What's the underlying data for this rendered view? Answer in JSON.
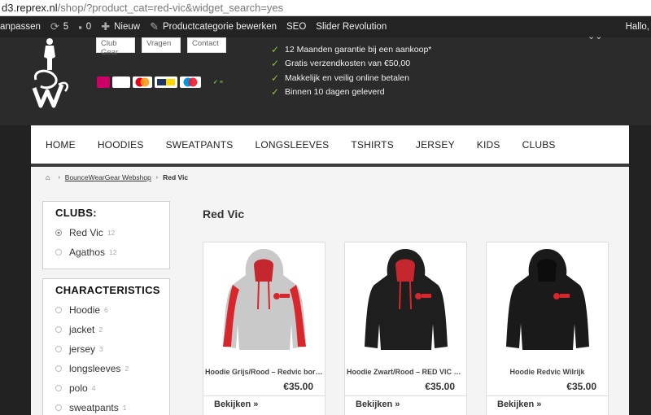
{
  "browser": {
    "url_host": "d3.reprex.nl",
    "url_path": "/shop/?product_cat=red-vic&widget_search=yes"
  },
  "adminbar": {
    "customize": "anpassen",
    "updates_count": "5",
    "comments_count": "0",
    "new_label": "Nieuw",
    "edit_label": "Productcategorie bewerken",
    "seo_label": "SEO",
    "slider_label": "Slider Revolution",
    "greeting": "Hallo,"
  },
  "header": {
    "top_links": [
      "Club Gear",
      "Vragen",
      "Contact"
    ],
    "payment_icons": [
      "iDEAL",
      "VISA",
      "MasterCard",
      "Bancontact",
      "Maestro",
      "veilig boeking"
    ],
    "usps": [
      "12 Maanden garantie bij een aankoop*",
      "Gratis verzendkosten van €50,00",
      "Makkelijk en veilig online betalen",
      "Binnen 10 dagen geleverd"
    ],
    "brand_color": "#2b2b2b",
    "check_color": "#8ac43f"
  },
  "nav": {
    "items": [
      "HOME",
      "HOODIES",
      "SWEATPANTS",
      "LONGSLEEVES",
      "TSHIRTS",
      "JERSEY",
      "KIDS",
      "CLUBS"
    ]
  },
  "breadcrumb": {
    "shop": "BounceWearGear Webshop",
    "current": "Red Vic"
  },
  "sidebar": {
    "clubs": {
      "title": "CLUBS:",
      "items": [
        {
          "label": "Red Vic",
          "count": "12",
          "selected": true
        },
        {
          "label": "Agathos",
          "count": "12",
          "selected": false
        }
      ]
    },
    "characteristics": {
      "title": "CHARACTERISTICS",
      "items": [
        {
          "label": "Hoodie",
          "count": "6"
        },
        {
          "label": "jacket",
          "count": "2"
        },
        {
          "label": "jersey",
          "count": "3"
        },
        {
          "label": "longsleeves",
          "count": "2"
        },
        {
          "label": "polo",
          "count": "4"
        },
        {
          "label": "sweatpants",
          "count": "1"
        }
      ]
    }
  },
  "category": {
    "title": "Red Vic"
  },
  "products": [
    {
      "name": "Hoodie Grijs/Rood – Redvic borstlogo",
      "price": "€35.00",
      "button": "Bekijken »",
      "body_color": "#c8c8c8",
      "accent": "#d7262c"
    },
    {
      "name": "Hoodie Zwart/Rood – RED VIC Wilrijk",
      "price": "€35.00",
      "button": "Bekijken »",
      "body_color": "#1e1e1e",
      "accent": "#d7262c"
    },
    {
      "name": "Hoodie Redvic Wilrijk",
      "price": "€35.00",
      "button": "Bekijken »",
      "body_color": "#1a1a1a",
      "accent": "#1a1a1a"
    }
  ]
}
